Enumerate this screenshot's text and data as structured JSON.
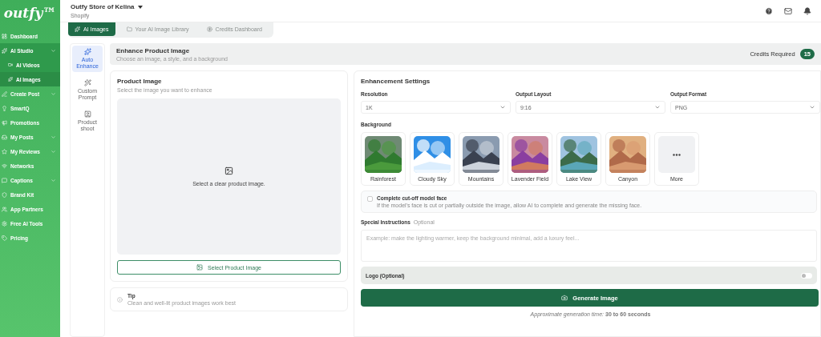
{
  "sidebar": {
    "logo": "outfy™",
    "items": [
      {
        "label": "Dashboard",
        "kind": "link",
        "selected": false
      },
      {
        "label": "AI Studio",
        "kind": "group",
        "selected": true,
        "children": [
          {
            "label": "AI Videos",
            "selected": false
          },
          {
            "label": "AI Images",
            "selected": true
          }
        ]
      },
      {
        "label": "Create Post",
        "kind": "group",
        "selected": false
      },
      {
        "label": "SmartQ",
        "kind": "link",
        "selected": false
      },
      {
        "label": "Promotions",
        "kind": "link",
        "selected": false
      },
      {
        "label": "My Posts",
        "kind": "group",
        "selected": false
      },
      {
        "label": "My Reviews",
        "kind": "group",
        "selected": false
      },
      {
        "label": "Networks",
        "kind": "link",
        "selected": false
      },
      {
        "label": "Captions",
        "kind": "group",
        "selected": false
      },
      {
        "label": "Brand Kit",
        "kind": "link",
        "selected": false
      },
      {
        "label": "App Partners",
        "kind": "link",
        "selected": false
      },
      {
        "label": "Free AI Tools",
        "kind": "link",
        "selected": false
      },
      {
        "label": "Pricing",
        "kind": "link",
        "selected": false
      }
    ]
  },
  "header": {
    "store": "Outfy Store of Kelina",
    "platform": "Shopify"
  },
  "tabs": [
    {
      "label": "AI Images",
      "selected": true
    },
    {
      "label": "Your AI Image Library",
      "selected": false
    },
    {
      "label": "Credits Dashboard",
      "selected": false
    }
  ],
  "modes": [
    {
      "label": "Auto Enhance",
      "selected": true
    },
    {
      "label": "Custom Prompt",
      "selected": false
    },
    {
      "label": "Product shoot",
      "selected": false
    }
  ],
  "section": {
    "title": "Enhance Product Image",
    "subtitle": "Choose an image, a style, and a background",
    "credits_label": "Credits Required",
    "credits": "15"
  },
  "product_image": {
    "title": "Product Image",
    "subtitle": "Select the image you want to enhance",
    "drop_text": "Select a clear product image.",
    "button": "Select Product Image"
  },
  "tip": {
    "title": "Tip",
    "text": "Clean and well-lit product images work best"
  },
  "settings": {
    "title": "Enhancement Settings",
    "selects": [
      {
        "label": "Resolution",
        "value": "1K"
      },
      {
        "label": "Output Layout",
        "value": "9:16"
      },
      {
        "label": "Output Format",
        "value": "PNG"
      }
    ],
    "background_label": "Background",
    "backgrounds": [
      {
        "label": "Rainforest",
        "kind": "picture",
        "selected": false
      },
      {
        "label": "Cloudy Sky",
        "kind": "picture",
        "selected": false
      },
      {
        "label": "Mountains",
        "kind": "picture",
        "selected": false
      },
      {
        "label": "Lavender Field",
        "kind": "picture",
        "selected": false
      },
      {
        "label": "Lake View",
        "kind": "picture",
        "selected": false
      },
      {
        "label": "Canyon",
        "kind": "picture",
        "selected": false
      },
      {
        "label": "More",
        "kind": "more",
        "selected": false
      }
    ],
    "face": {
      "title": "Complete cut-off model face",
      "text": "If the model's face is cut or partially outside the image, allow AI to complete and generate the missing face.",
      "checked": false
    },
    "instructions_label": "Special Instructions",
    "instructions_hint": "Optional",
    "instructions_placeholder": "Example: make the lighting warmer, keep the background minimal, add a luxury feel...",
    "logo": {
      "label": "Logo (Optional)",
      "on": false
    },
    "generate": "Generate Image",
    "note": "*Approximate generation time:* **30 to 60 seconds**"
  }
}
